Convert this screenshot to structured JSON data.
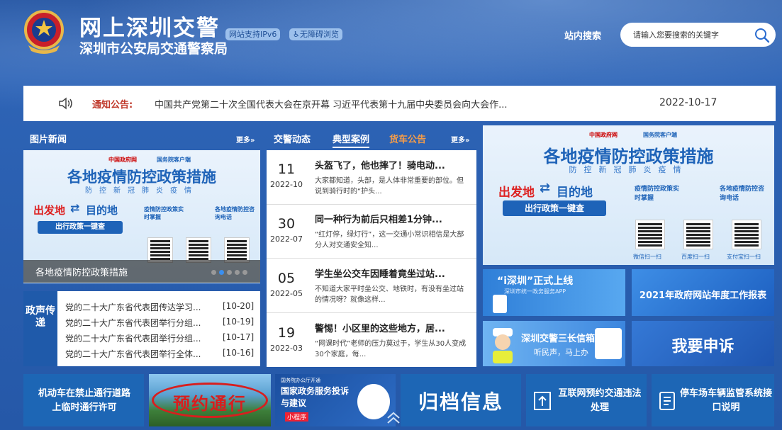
{
  "header": {
    "title": "网上深圳交警",
    "subtitle": "深圳市公安局交通警察局",
    "tag_ipv6": "网站支持IPv6",
    "tag_access": "♿无障碍浏览",
    "search_label": "站内搜索",
    "search_placeholder": "请输入您要搜索的关键字"
  },
  "notice": {
    "label": "通知公告:",
    "text": "中国共产党第二十次全国代表大会在京开幕 习近平代表第十九届中央委员会向大会作...",
    "date": "2022-10-17"
  },
  "photo_news": {
    "title": "图片新闻",
    "more": "更多»",
    "caption": "各地疫情防控政策措施",
    "active_slide": 1,
    "slides": 5
  },
  "poster": {
    "gov": "中国政府网",
    "gov2": "国务院客户端",
    "headline": "各地疫情防控政策措施",
    "subline": "防控新冠肺炎疫情",
    "from": "出发地",
    "arrow": "⇄",
    "to": "目的地",
    "button": "出行政策一键查",
    "side1": "疫情防控政策实时掌握",
    "side2": "各地疫情防控咨询电话",
    "scan1": "微信扫一扫",
    "scan2": "百度扫一扫",
    "scan3": "支付宝扫一扫"
  },
  "policy": {
    "label": "政声传递",
    "items": [
      {
        "title": "党的二十大广东省代表团传达学习...",
        "date": "[10-20]"
      },
      {
        "title": "党的二十大广东省代表团举行分组...",
        "date": "[10-19]"
      },
      {
        "title": "党的二十大广东省代表团举行分组...",
        "date": "[10-17]"
      },
      {
        "title": "党的二十大广东省代表团举行全体...",
        "date": "[10-16]"
      }
    ]
  },
  "tabs": {
    "items": [
      "交警动态",
      "典型案例",
      "货车公告"
    ],
    "active": 1,
    "more": "更多»"
  },
  "news": [
    {
      "day": "11",
      "ym": "2022-10",
      "title": "头盔飞了，他也摔了！骑电动...",
      "desc": "大家都知道，头部，是人体非常重要的部位。但说到骑行时的“护头..."
    },
    {
      "day": "30",
      "ym": "2022-07",
      "title": "同一种行为前后只相差1分钟...",
      "desc": "“红灯停，绿灯行”，这一交通小常识相信是大部分人对交通安全知..."
    },
    {
      "day": "05",
      "ym": "2022-05",
      "title": "学生坐公交车因睡着竟坐过站...",
      "desc": "不知道大家平时坐公交、地铁时，有没有坐过站的情况呀？就像这样..."
    },
    {
      "day": "19",
      "ym": "2022-03",
      "title": "警惕！小区里的这些地方，居...",
      "desc": "“网课时代”老师的压力莫过于，学生从30人变成30个家庭，每..."
    }
  ],
  "banners": {
    "ishenzhen": "“i深圳”正式上线",
    "ishenzhen_sub": "深圳市统一政务服务APP",
    "annual_report": "2021年政府网站年度工作报表",
    "mailbox": "深圳交警三长信箱",
    "mailbox_sub": "听民声，马上办",
    "complaint": "我要申诉"
  },
  "bottom": {
    "permit": "机动车在禁止通行道路上临时通行许可",
    "reserve": "预约通行",
    "gov_service": "国家政务服务投诉与建议",
    "gov_service_tag": "小程序",
    "gov_top": "国务院办公厅开通",
    "archive": "归档信息",
    "violation": "互联网预约交通违法处理",
    "parking": "停车场车辆监管系统接口说明"
  },
  "colors": {
    "primary": "#1f5aaa",
    "alert": "#c0392b",
    "orange_tab": "#f39c4a",
    "poster_blue": "#1e63b8"
  }
}
